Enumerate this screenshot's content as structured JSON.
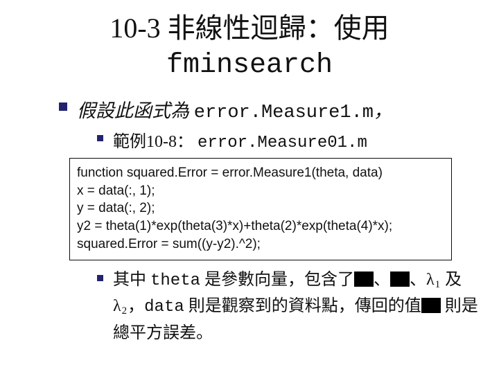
{
  "title_line1": "10-3 非線性迴歸：使用",
  "title_line2": "fminsearch",
  "assume_text_prefix": "假設此函式為 ",
  "assume_code": "error.Measure1.m",
  "assume_text_suffix": "，",
  "example_label": "範例10-8： ",
  "example_code": "error.Measure01.m",
  "code": {
    "l1": "function squared.Error = error.Measure1(theta, data)",
    "l2": "x = data(:, 1);",
    "l3": "y = data(:, 2);",
    "l4": "y2 = theta(1)*exp(theta(3)*x)+theta(2)*exp(theta(4)*x);",
    "l5": "squared.Error = sum((y-y2).^2);"
  },
  "desc": {
    "pre": "其中 ",
    "theta": "theta",
    "mid1": " 是參數向量，包含了",
    "sep1": "、",
    "sep2": "、",
    "lam": "λ",
    "sub1": "1",
    "and": " 及 ",
    "sub2": "2",
    "comma": "，",
    "datalit": "data",
    "mid2": " 則是觀察到的資料點，傳回的值",
    "tail": " 則是總平方誤差。"
  }
}
